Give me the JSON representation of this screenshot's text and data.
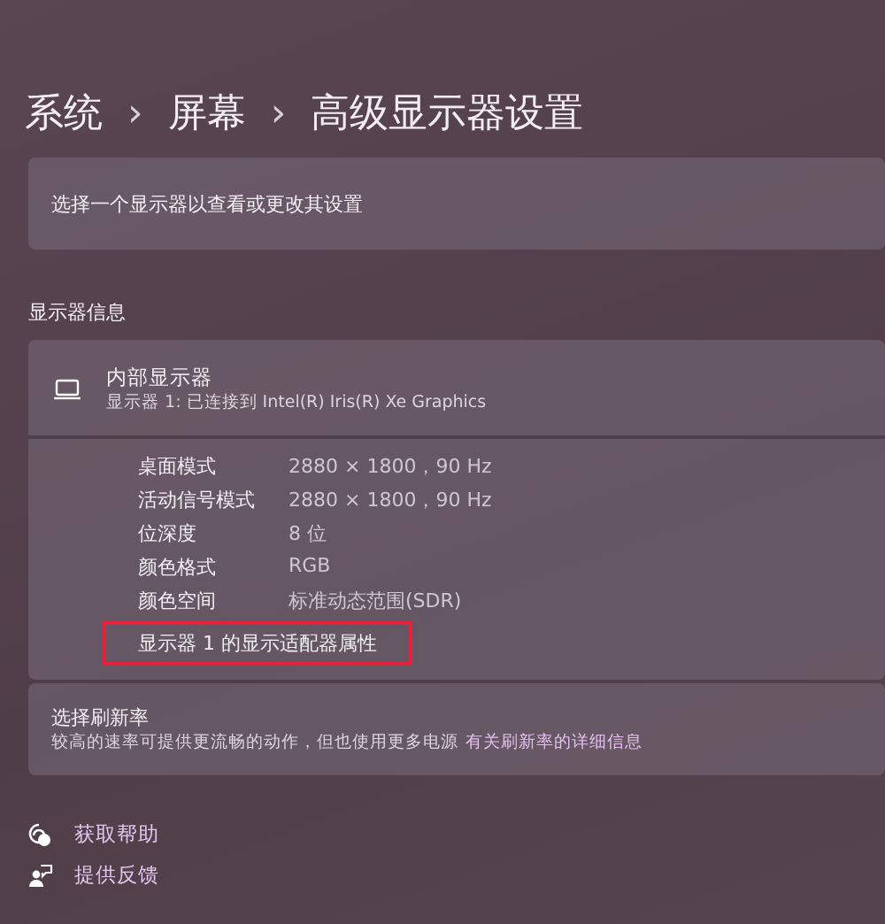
{
  "breadcrumb": [
    {
      "label": "系统"
    },
    {
      "label": "›"
    },
    {
      "label": "屏幕"
    },
    {
      "label": "›"
    },
    {
      "label": "高级显示器设置"
    }
  ],
  "select_display": {
    "label": "选择一个显示器以查看或更改其设置"
  },
  "section_title": "显示器信息",
  "display": {
    "name": "内部显示器",
    "subtitle": "显示器 1: 已连接到 Intel(R) Iris(R) Xe Graphics",
    "properties": [
      {
        "label": "桌面模式",
        "value": "2880 × 1800，90 Hz"
      },
      {
        "label": "活动信号模式",
        "value": "2880 × 1800，90 Hz"
      },
      {
        "label": "位深度",
        "value": "8 位"
      },
      {
        "label": "颜色格式",
        "value": "RGB"
      },
      {
        "label": "颜色空间",
        "value": "标准动态范围(SDR)"
      }
    ],
    "adapter_link": {
      "label": "显示器 1 的显示适配器属性",
      "highlighted": true
    }
  },
  "refresh_rate": {
    "title": "选择刷新率",
    "description": "较高的速率可提供更流畅的动作，但也使用更多电源",
    "link": "有关刷新率的详细信息"
  },
  "footer_links": [
    {
      "kind": "help",
      "label": "获取帮助"
    },
    {
      "kind": "feedback",
      "label": "提供反馈"
    }
  ]
}
